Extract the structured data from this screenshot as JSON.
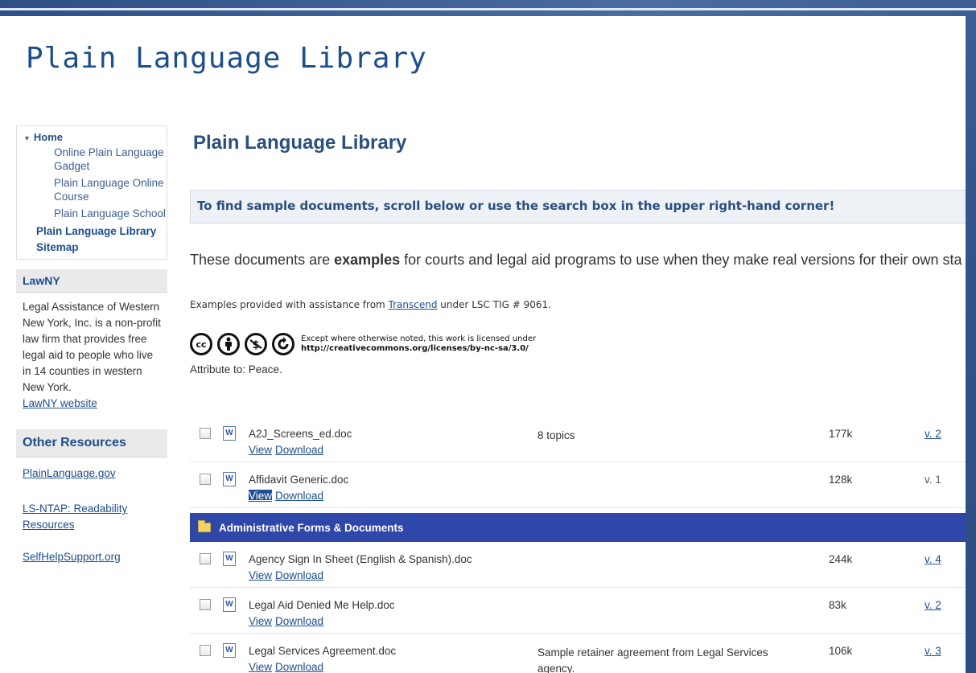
{
  "slide_title": "Plain Language Library",
  "sidebar": {
    "home_label": "Home",
    "home_children": [
      "Online Plain Language Gadget",
      "Plain Language Online Course",
      "Plain Language School"
    ],
    "items": [
      "Plain Language Library",
      "Sitemap"
    ],
    "lawny": {
      "heading": "LawNY",
      "text": "Legal Assistance of Western New York, Inc. is a non-profit law firm that provides free legal aid to people who live in 14 counties in western New York.",
      "link": "LawNY website"
    },
    "resources": {
      "heading": "Other Resources",
      "links": [
        "PlainLanguage.gov",
        "LS-NTAP: Readability Resources",
        "SelfHelpSupport.org"
      ]
    }
  },
  "main": {
    "title": "Plain Language Library",
    "banner": "To find sample documents, scroll below or use the search box in the upper right-hand corner!",
    "intro_before": "These documents are ",
    "intro_bold": "examples",
    "intro_after": " for courts and legal aid programs to use when they make real versions for their own sta",
    "credit_before": "Examples provided with assistance from ",
    "credit_link": "Transcend",
    "credit_after": " under LSC TIG # 9061.",
    "cc_icons": [
      "cc",
      "by",
      "nc",
      "sa"
    ],
    "license_line1": "Except where otherwise noted, this work is licensed under",
    "license_line2": "http://creativecommons.org/licenses/by-nc-sa/3.0/",
    "attribution": "Attribute to: Peace.",
    "view_label": "View",
    "download_label": "Download",
    "folder_label": "Administrative Forms & Documents",
    "docs": [
      {
        "name": "A2J_Screens_ed.doc",
        "desc": "8 topics",
        "size": "177k",
        "version": "v. 2"
      },
      {
        "name": "Affidavit Generic.doc",
        "desc": "",
        "size": "128k",
        "version": "v. 1"
      },
      {
        "name": "Agency Sign In Sheet (English & Spanish).doc",
        "desc": "",
        "size": "244k",
        "version": "v. 4"
      },
      {
        "name": "Legal Aid Denied Me Help.doc",
        "desc": "",
        "size": "83k",
        "version": "v. 2"
      },
      {
        "name": "Legal Services Agreement.doc",
        "desc": "Sample retainer agreement from Legal Services agency.",
        "size": "106k",
        "version": "v. 3"
      }
    ]
  },
  "colors": {
    "accent": "#1d4e8c",
    "folder_bar": "#2f47a8",
    "background": "#3a5b8f"
  }
}
